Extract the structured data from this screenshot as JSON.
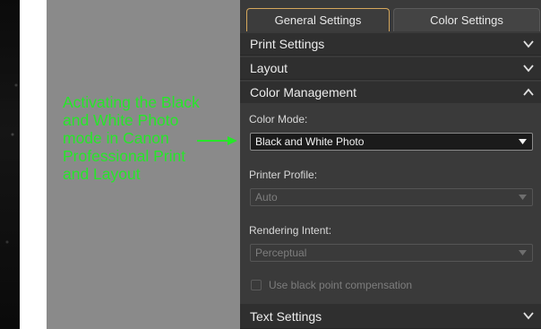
{
  "annotation": {
    "lines": [
      "Activating the Black",
      "and White Photo",
      "mode in Canon",
      "Professional Print",
      "and Layout"
    ]
  },
  "tabs": [
    {
      "label": "General Settings",
      "active": true
    },
    {
      "label": "Color Settings",
      "active": false
    }
  ],
  "sections": {
    "print_settings": {
      "label": "Print Settings",
      "expanded": false
    },
    "layout": {
      "label": "Layout",
      "expanded": false
    },
    "color_management": {
      "label": "Color Management",
      "expanded": true
    },
    "text_settings": {
      "label": "Text Settings",
      "expanded": false
    }
  },
  "color_management": {
    "color_mode": {
      "label": "Color Mode:",
      "value": "Black and White Photo",
      "enabled": true
    },
    "printer_profile": {
      "label": "Printer Profile:",
      "value": "Auto",
      "enabled": false
    },
    "rendering_intent": {
      "label": "Rendering Intent:",
      "value": "Perceptual",
      "enabled": false
    },
    "black_point": {
      "label": "Use black point compensation",
      "checked": false,
      "enabled": false
    }
  },
  "icons": {
    "collapsed": "chevron-down-icon",
    "expanded": "chevron-up-icon",
    "dropdown": "caret-down-icon"
  },
  "colors": {
    "annotation": "#27e62a",
    "active_tab_border": "#d6a85c",
    "panel_bg": "#3a3a3a",
    "header_bg": "#2f2f2f"
  }
}
